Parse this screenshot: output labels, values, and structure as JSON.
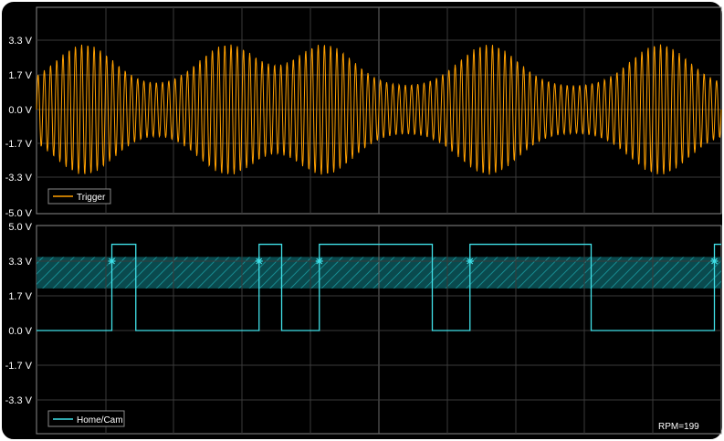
{
  "colors": {
    "background": "#000000",
    "frame": "#ffffff",
    "grid": "#3a3a3a",
    "trigger": "#ffa000",
    "cam": "#40e0e8",
    "band": "#0e7a80"
  },
  "chart_data": [
    {
      "type": "line",
      "title": "",
      "series": [
        {
          "name": "Trigger"
        }
      ],
      "y_ticks": [
        "3.3 V",
        "1.7 V",
        "0.0 V",
        "-1.7 V",
        "-3.3 V",
        "-5.0 V"
      ],
      "ylim": [
        -5.0,
        5.0
      ],
      "envelope": {
        "description": "oscillating AC signal, amplitude peaks around 3.0 V near x=0.07, 0.28, 0.42, 0.66, 0.91 (fraction of sweep)",
        "peak_amplitude_v": 3.1,
        "min_amplitude_v": 1.1
      },
      "grid": true,
      "legend": "bottom-left"
    },
    {
      "type": "line",
      "title": "",
      "series": [
        {
          "name": "Home/Cam"
        }
      ],
      "y_ticks": [
        "5.0 V",
        "3.3 V",
        "1.7 V",
        "0.0 V",
        "-1.7 V",
        "-3.3 V"
      ],
      "ylim": [
        -5.0,
        5.0
      ],
      "threshold_band_v": [
        2.0,
        3.5
      ],
      "high_v": 4.1,
      "low_v": 0.0,
      "transitions_fraction": [
        [
          0.0,
          0.0
        ],
        [
          0.11,
          0.0
        ],
        [
          0.11,
          4.1
        ],
        [
          0.145,
          4.1
        ],
        [
          0.145,
          0.0
        ],
        [
          0.325,
          0.0
        ],
        [
          0.325,
          4.1
        ],
        [
          0.358,
          4.1
        ],
        [
          0.358,
          0.0
        ],
        [
          0.413,
          0.0
        ],
        [
          0.413,
          4.1
        ],
        [
          0.578,
          4.1
        ],
        [
          0.578,
          0.0
        ],
        [
          0.633,
          0.0
        ],
        [
          0.633,
          4.1
        ],
        [
          0.81,
          4.1
        ],
        [
          0.81,
          0.0
        ],
        [
          0.99,
          0.0
        ],
        [
          0.99,
          4.1
        ],
        [
          1.0,
          4.1
        ]
      ],
      "markers_fraction": [
        0.11,
        0.325,
        0.413,
        0.633,
        0.99
      ],
      "grid": true,
      "legend": "bottom-left"
    }
  ],
  "rpm_label": "RPM=199"
}
